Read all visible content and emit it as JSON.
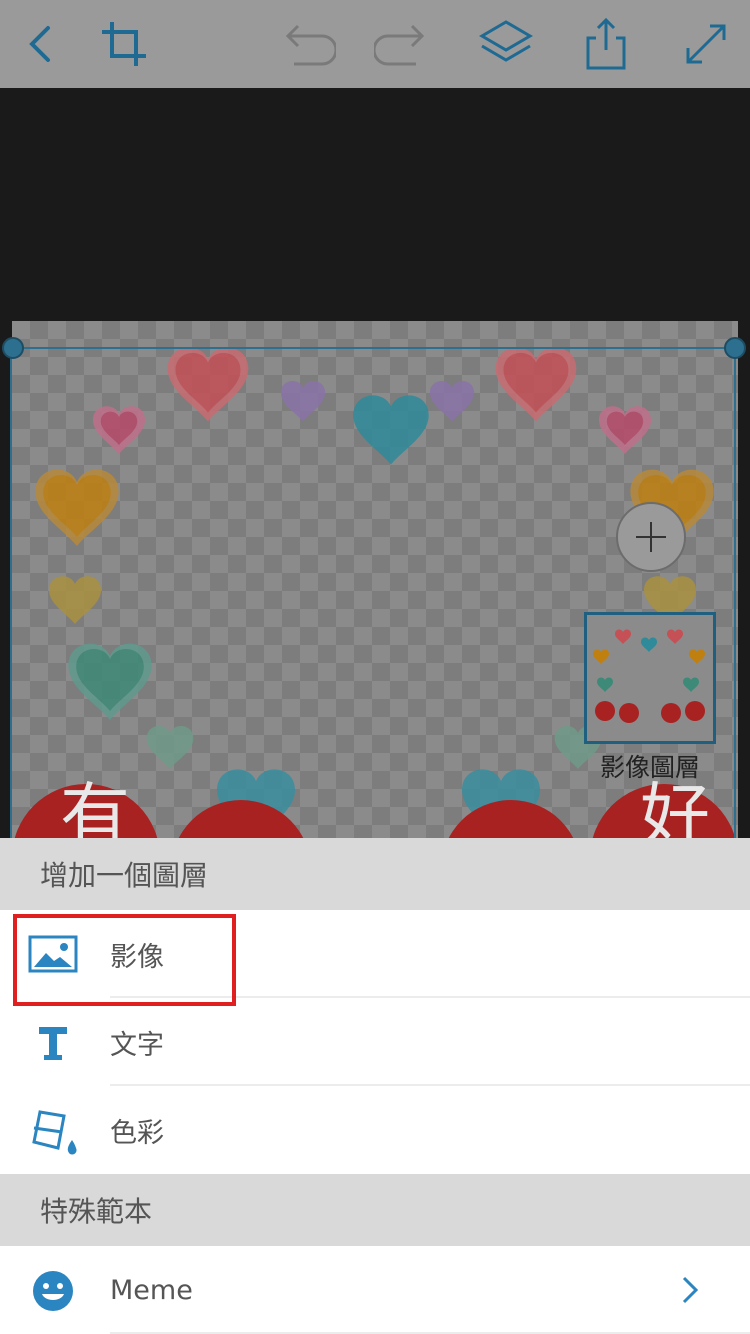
{
  "toolbar": {
    "icons": [
      "back-icon",
      "crop-icon",
      "undo-icon",
      "redo-icon",
      "layers-icon",
      "share-icon",
      "expand-icon"
    ],
    "accent_color": "#2d6f8e"
  },
  "canvas": {
    "layer_thumbnail_label": "影像圖層",
    "add_button_icon": "plus-icon"
  },
  "sheet": {
    "add_layer_header": "增加一個圖層",
    "items": [
      {
        "label": "影像",
        "icon": "image-icon"
      },
      {
        "label": "文字",
        "icon": "text-icon"
      },
      {
        "label": "色彩",
        "icon": "paint-bucket-icon"
      }
    ],
    "templates_header": "特殊範本",
    "template_items": [
      {
        "label": "Meme",
        "icon": "smiley-icon"
      }
    ]
  },
  "colors": {
    "icon_blue": "#2a85c0",
    "highlight_red": "#e02020"
  }
}
